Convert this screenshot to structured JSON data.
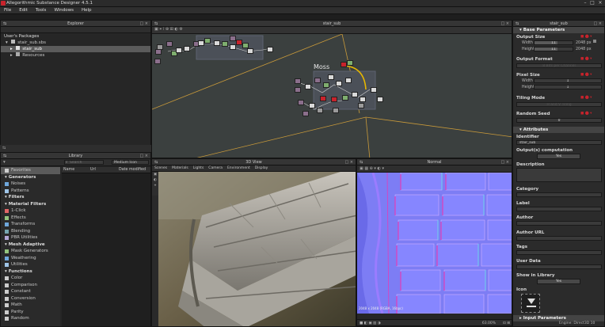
{
  "window": {
    "title": "Allegorithmic Substance Designer 4.5.1"
  },
  "menu": [
    "File",
    "Edit",
    "Tools",
    "Windows",
    "Help"
  ],
  "explorer": {
    "title": "Explorer",
    "header": "User's Packages",
    "tree": [
      "stair_sub.sbs",
      "stair_sub",
      "Resources"
    ]
  },
  "graph": {
    "title": "stair_sub",
    "frame_label": "Moss",
    "node_colors": {
      "output": "#d9d9d9",
      "green": "#7fae6f",
      "red": "#c8232c",
      "mauve": "#8b6f8c",
      "gray": "#9a9a9a"
    }
  },
  "library": {
    "title": "Library",
    "search_placeholder": "Search",
    "view_mode": "Medium Icon",
    "columns": [
      "Name",
      "Url",
      "Date modified"
    ],
    "sidebar": [
      {
        "label": "Favorites",
        "type": "item",
        "icon": "star-icon"
      },
      {
        "label": "Generators",
        "type": "cat"
      },
      {
        "label": "Noises",
        "type": "item",
        "icon": "noise-icon"
      },
      {
        "label": "Patterns",
        "type": "item",
        "icon": "pattern-icon"
      },
      {
        "label": "Filters",
        "type": "cat"
      },
      {
        "label": "Material Filters",
        "type": "cat"
      },
      {
        "label": "1-Click",
        "type": "item",
        "icon": "heart-icon"
      },
      {
        "label": "Effects",
        "type": "item",
        "icon": "effects-icon"
      },
      {
        "label": "Transforms",
        "type": "item",
        "icon": "transform-icon"
      },
      {
        "label": "Blending",
        "type": "item",
        "icon": "blend-icon"
      },
      {
        "label": "PBR Utilities",
        "type": "item",
        "icon": "pbr-icon"
      },
      {
        "label": "Mesh Adaptive",
        "type": "cat"
      },
      {
        "label": "Mask Generators",
        "type": "item",
        "icon": "mask-icon"
      },
      {
        "label": "Weathering",
        "type": "item",
        "icon": "weather-icon"
      },
      {
        "label": "Utilities",
        "type": "item",
        "icon": "utility-icon"
      },
      {
        "label": "Functions",
        "type": "cat"
      },
      {
        "label": "Color",
        "type": "item",
        "icon": "function-icon"
      },
      {
        "label": "Comparison",
        "type": "item",
        "icon": "function-icon"
      },
      {
        "label": "Constant",
        "type": "item",
        "icon": "function-icon"
      },
      {
        "label": "Conversion",
        "type": "item",
        "icon": "function-icon"
      },
      {
        "label": "Math",
        "type": "item",
        "icon": "function-icon"
      },
      {
        "label": "Parity",
        "type": "item",
        "icon": "function-icon"
      },
      {
        "label": "Random",
        "type": "item",
        "icon": "function-icon"
      }
    ]
  },
  "view3d": {
    "title": "3D View",
    "menu": [
      "Scenes",
      "Materials",
      "Lights",
      "Camera",
      "Environment",
      "Display"
    ]
  },
  "view2d": {
    "title": "Normal",
    "status": "2048 x 2048 (RGBA, 16bpc)",
    "zoom": "63.00%"
  },
  "props": {
    "title": "stair_sub",
    "base_section": "Base Parameters",
    "output_size_label": "Output Size",
    "width_label": "Width",
    "height_label": "Height",
    "width_slider": "11",
    "height_slider": "11",
    "width_value": "2048 px",
    "height_value": "2048 px",
    "output_format_label": "Output Format",
    "output_format_value": "8 Bits per Channel",
    "pixel_size_label": "Pixel Size",
    "px_width_value": "1",
    "px_height_value": "1",
    "tiling_label": "Tiling Mode",
    "tiling_value": "H and V Tiling",
    "random_seed_label": "Random Seed",
    "random_seed_value": "0",
    "attributes_section": "Attributes",
    "identifier_label": "Identifier",
    "identifier_value": "stair_sub",
    "outputs_comp_label": "Output(s) computation",
    "outputs_comp_value": "Yes",
    "description_label": "Description",
    "category_label": "Category",
    "label_label": "Label",
    "author_label": "Author",
    "author_url_label": "Author URL",
    "tags_label": "Tags",
    "user_data_label": "User Data",
    "show_library_label": "Show in Library",
    "show_library_value": "Yes",
    "icon_label": "Icon",
    "input_section": "Input Parameters",
    "engine": "Engine: Direct3D 10"
  }
}
